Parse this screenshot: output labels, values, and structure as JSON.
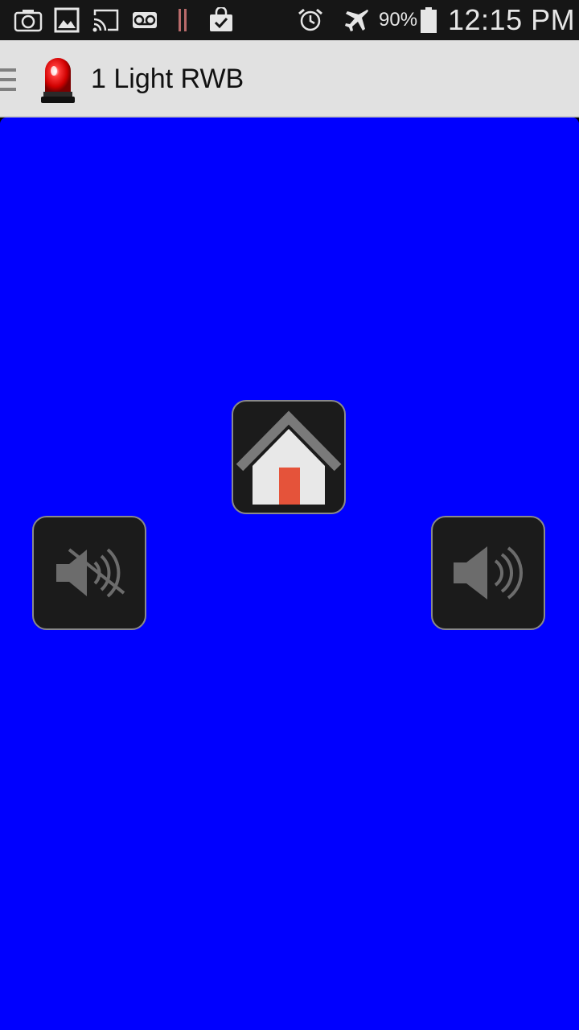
{
  "status_bar": {
    "icons": [
      "camera-icon",
      "gallery-icon",
      "cast-icon",
      "voicemail-icon",
      "signal-bars-icon",
      "shopping-bag-check-icon",
      "alarm-icon",
      "airplane-mode-icon",
      "battery-icon"
    ],
    "battery_percent": "90%",
    "time": "12:15 PM"
  },
  "action_bar": {
    "nav_icon": "hamburger-icon",
    "app_icon": "red-siren-light-icon",
    "title": "1 Light RWB"
  },
  "main": {
    "background_color": "#0000ff",
    "buttons": [
      {
        "name": "home",
        "icon": "home-icon"
      },
      {
        "name": "mute",
        "icon": "speaker-muted-icon"
      },
      {
        "name": "sound",
        "icon": "speaker-volume-icon"
      }
    ]
  },
  "colors": {
    "status_bar_bg": "#161616",
    "action_bar_bg": "#e1e1e1",
    "tile_bg": "#1b1b1b",
    "tile_border": "#8a8a8a",
    "door": "#e5533a"
  }
}
